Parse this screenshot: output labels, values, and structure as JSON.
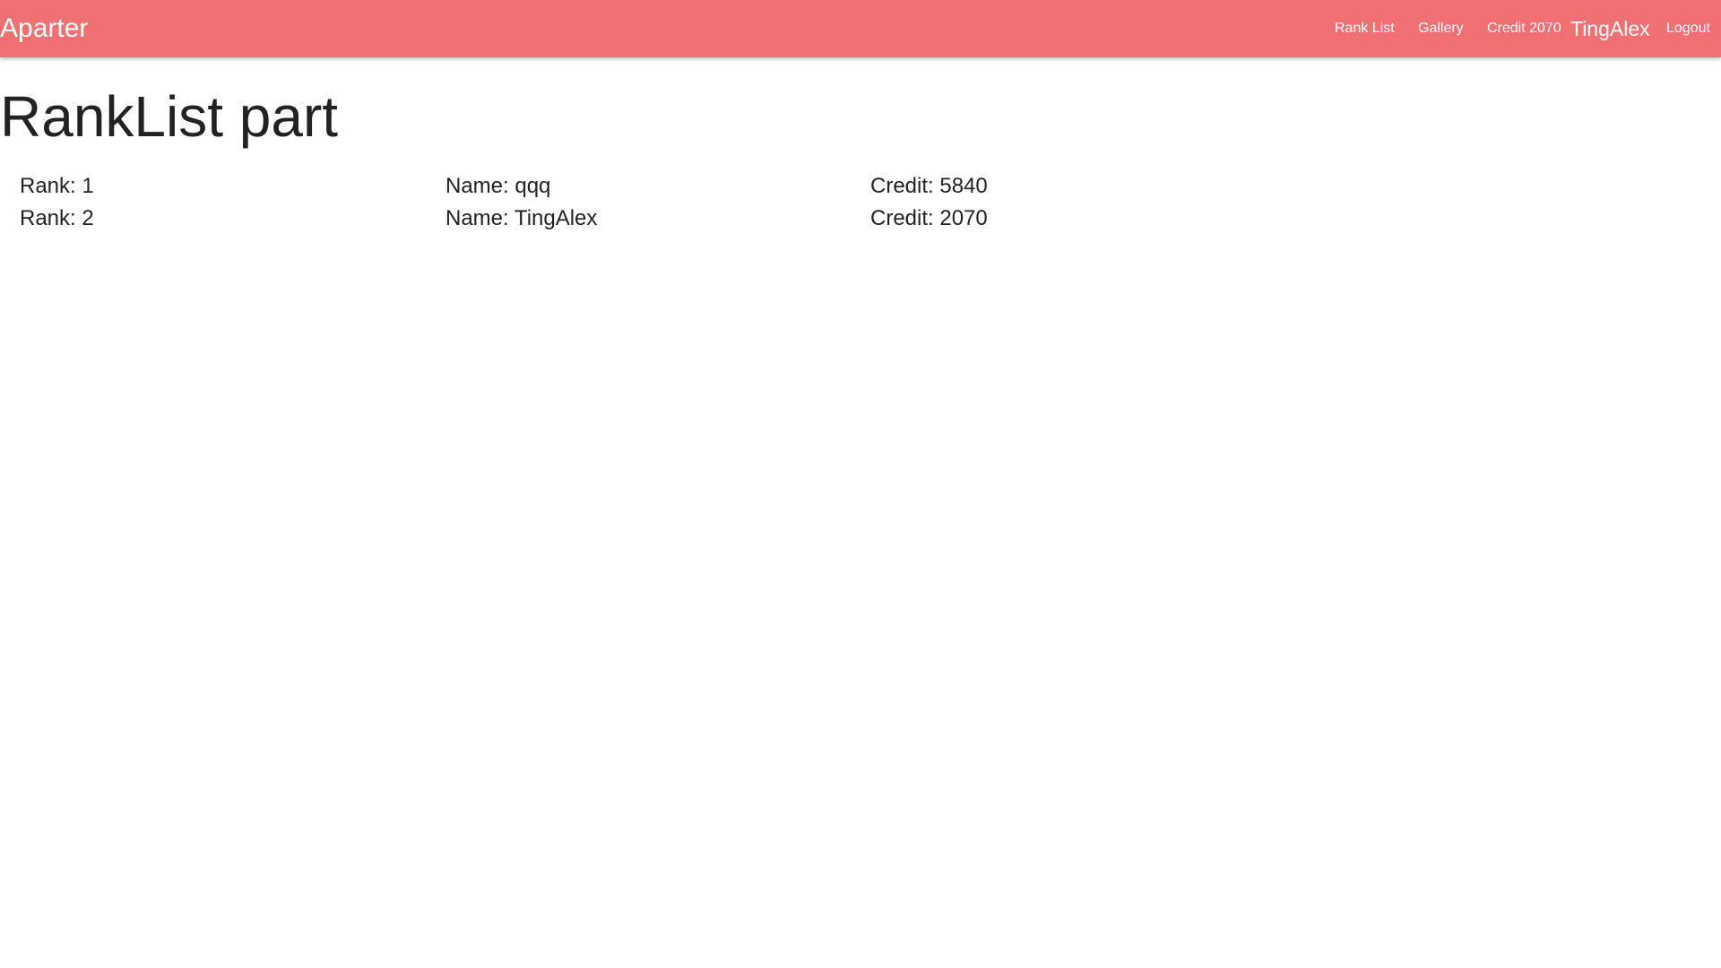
{
  "navbar": {
    "brand": "Aparter",
    "links": {
      "rank_list": "Rank List",
      "gallery": "Gallery",
      "credit": "Credit 2070",
      "username": "TingAlex",
      "logout": "Logout"
    },
    "bg_color": "#f07073"
  },
  "main": {
    "title": "RankList part",
    "rows": [
      {
        "rank": "Rank: 1",
        "name": "Name: qqq",
        "credit": "Credit: 5840"
      },
      {
        "rank": "Rank: 2",
        "name": "Name: TingAlex",
        "credit": "Credit: 2070"
      }
    ]
  }
}
